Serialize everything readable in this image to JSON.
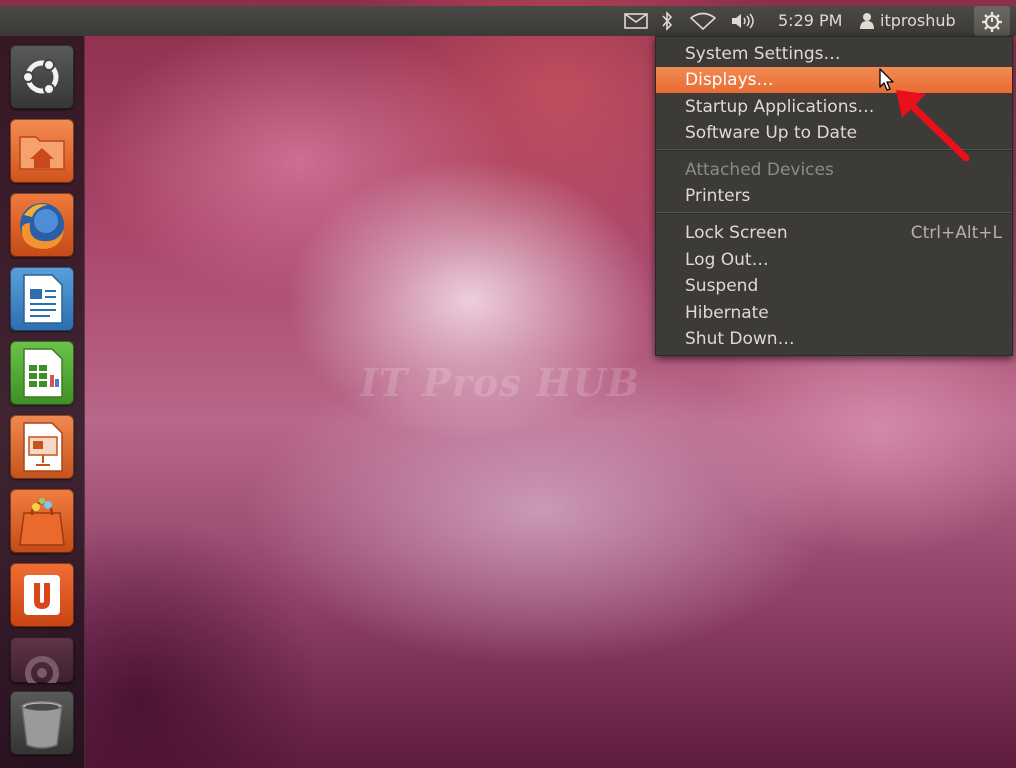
{
  "panel": {
    "clock": "5:29 PM",
    "username": "itproshub",
    "indicators": [
      "mail-icon",
      "bluetooth-icon",
      "wifi-icon",
      "volume-icon"
    ],
    "settings_icon": "gear-power-icon"
  },
  "launcher": {
    "items": [
      {
        "name": "Dash Home",
        "icon": "ubuntu-logo-icon",
        "color": "#4a4a4a"
      },
      {
        "name": "Home Folder",
        "icon": "home-folder-icon",
        "color": "#e2682f"
      },
      {
        "name": "Firefox Web Browser",
        "icon": "firefox-icon",
        "color": "#d45a22"
      },
      {
        "name": "LibreOffice Writer",
        "icon": "writer-icon",
        "color": "#3f86c6"
      },
      {
        "name": "LibreOffice Calc",
        "icon": "calc-icon",
        "color": "#4fa83a"
      },
      {
        "name": "LibreOffice Impress",
        "icon": "impress-icon",
        "color": "#d8642a"
      },
      {
        "name": "Ubuntu Software Center",
        "icon": "software-center-icon",
        "color": "#e06225"
      },
      {
        "name": "Ubuntu One",
        "icon": "ubuntu-one-icon",
        "color": "#e05a20"
      },
      {
        "name": "System Settings",
        "icon": "settings-icon",
        "color": "#5a3040"
      },
      {
        "name": "Trash",
        "icon": "trash-icon",
        "color": "#4a4a4a"
      }
    ]
  },
  "menu": {
    "system_settings": "System Settings…",
    "displays": "Displays…",
    "startup_applications": "Startup Applications…",
    "software_up_to_date": "Software Up to Date",
    "attached_devices": "Attached Devices",
    "printers": "Printers",
    "lock_screen": "Lock Screen",
    "lock_screen_shortcut": "Ctrl+Alt+L",
    "log_out": "Log Out…",
    "suspend": "Suspend",
    "hibernate": "Hibernate",
    "shut_down": "Shut Down…"
  },
  "watermark": "IT Pros HUB",
  "colors": {
    "accent": "#e86c33",
    "panel": "#3c3b37",
    "annotation_arrow": "#e8101a"
  }
}
